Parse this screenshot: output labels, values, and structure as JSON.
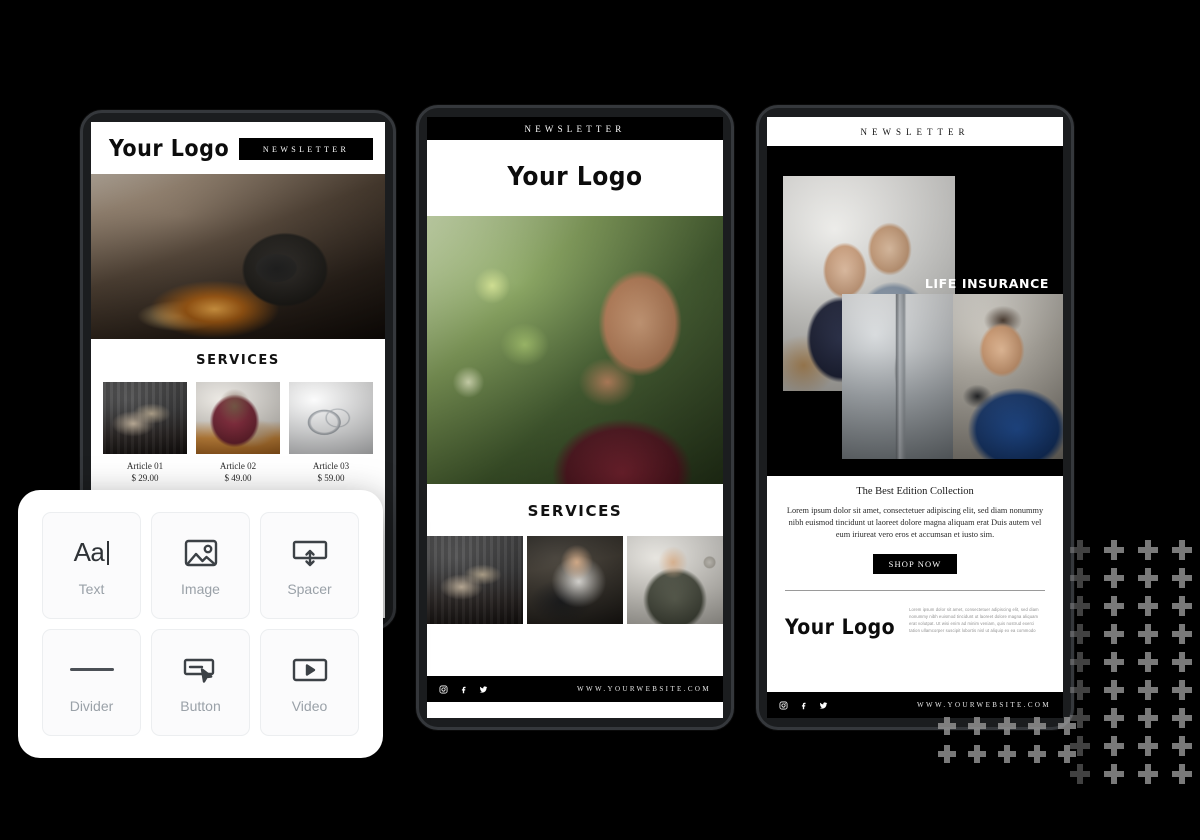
{
  "page": {
    "background": "#000000",
    "accent": "#000000",
    "panel_bg": "#ffffff"
  },
  "phone1": {
    "logo": "Your Logo",
    "badge": "NEWSLETTER",
    "hero_alt": "workshop-grinder-sparks",
    "section_title": "SERVICES",
    "cards": [
      {
        "name": "Article 01",
        "price": "$ 29.00",
        "image_alt": "tool-wall-workbench"
      },
      {
        "name": "Article 02",
        "price": "$ 49.00",
        "image_alt": "woman-at-laptop"
      },
      {
        "name": "Article 03",
        "price": "$ 59.00",
        "image_alt": "keys-and-rings"
      }
    ]
  },
  "phone2": {
    "top_bar": "NEWSLETTER",
    "logo": "Your Logo",
    "hero_alt": "man-on-phone-outdoors",
    "section_title": "SERVICES",
    "strip": [
      {
        "image_alt": "tool-wall-workbench"
      },
      {
        "image_alt": "man-at-desk-monitor"
      },
      {
        "image_alt": "smiling-man-with-phone"
      }
    ],
    "footer": {
      "website": "WWW.YOURWEBSITE.COM",
      "socials": [
        "instagram-icon",
        "facebook-icon",
        "twitter-icon"
      ]
    }
  },
  "phone3": {
    "top_bar": "NEWSLETTER",
    "headline": "LIFE INSURANCE",
    "images": [
      {
        "image_alt": "smiling-couple-in-room"
      },
      {
        "image_alt": "door-handle-lock-closeup"
      },
      {
        "image_alt": "technician-with-drill"
      }
    ],
    "edition_title": "The Best Edition Collection",
    "body_copy": "Lorem ipsum dolor sit amet, consectetuer adipiscing elit, sed diam nonummy nibh euismod tincidunt ut laoreet dolore magna aliquam erat Duis autem vel eum iriureat vero eros et accumsan et iusto sim.",
    "cta_label": "SHOP NOW",
    "logo": "Your Logo",
    "microcopy": "Lorem ipsum dolor sit amet, consectetuer adipiscing elit, sed diam nonummy nibh euismod tincidunt ut laoreet dolore magna aliquam erat volutpat. Ut wisi enim ad minim veniam, quis nostrud exerci tation ullamcorper suscipit lobortis nisl ut aliquip ex ea commodo",
    "footer": {
      "website": "WWW.YOURWEBSITE.COM",
      "socials": [
        "instagram-icon",
        "facebook-icon",
        "twitter-icon"
      ]
    }
  },
  "editor": {
    "tiles": [
      {
        "label": "Text",
        "icon": "text-aa-icon"
      },
      {
        "label": "Image",
        "icon": "image-icon"
      },
      {
        "label": "Spacer",
        "icon": "spacer-icon"
      },
      {
        "label": "Divider",
        "icon": "divider-icon"
      },
      {
        "label": "Button",
        "icon": "button-cursor-icon"
      },
      {
        "label": "Video",
        "icon": "video-play-icon"
      }
    ]
  },
  "decor": {
    "pattern": "plus-grid",
    "color": "#9b9b9b"
  }
}
